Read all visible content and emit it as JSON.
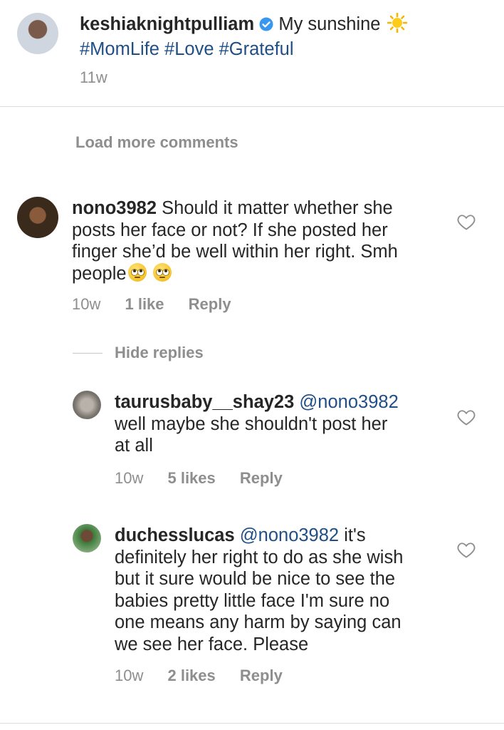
{
  "post": {
    "username": "keshiaknightpulliam",
    "caption": "My sunshine",
    "hashtags": "#MomLife #Love #Grateful",
    "time": "11w"
  },
  "load_more": "Load more comments",
  "comments": [
    {
      "username": "nono3982",
      "lines": [
        "Should it matter whether she",
        "posts her face or not? If she posted her",
        "finger she’d be well within her right. Smh",
        "people"
      ],
      "time": "10w",
      "likes": "1 like",
      "reply": "Reply"
    }
  ],
  "hide_replies": "Hide replies",
  "replies": [
    {
      "username": "taurusbaby__shay23",
      "mention": "@nono3982",
      "lines": [
        "well maybe she shouldn't post her",
        "at all"
      ],
      "time": "10w",
      "likes": "5 likes",
      "reply": "Reply"
    },
    {
      "username": "duchesslucas",
      "mention": "@nono3982",
      "first_tail": "it's",
      "lines": [
        "definitely her right to do as she wish",
        "but it sure would be nice to see the",
        "babies pretty little face I'm sure no",
        "one means any harm by saying can",
        "we see her face. Please"
      ],
      "time": "10w",
      "likes": "2 likes",
      "reply": "Reply"
    }
  ],
  "colors": {
    "link": "#1f4f86",
    "meta": "#8e8e8e",
    "divider": "#dbdbdb",
    "verified": "#3897f0"
  }
}
